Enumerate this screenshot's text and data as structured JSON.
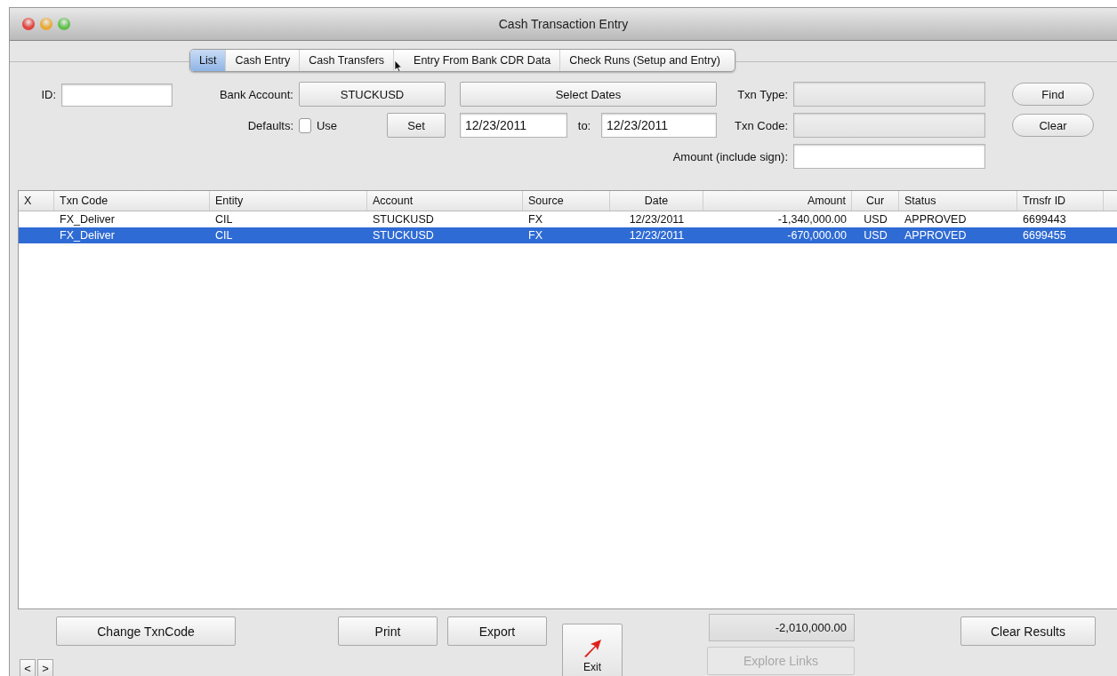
{
  "window": {
    "title": "Cash Transaction Entry"
  },
  "tabs": [
    {
      "label": "List",
      "selected": true
    },
    {
      "label": "Cash Entry",
      "selected": false
    },
    {
      "label": "Cash Transfers",
      "selected": false
    },
    {
      "label": "Entry From Bank CDR Data",
      "selected": false
    },
    {
      "label": "Check Runs (Setup and Entry)",
      "selected": false
    }
  ],
  "filters": {
    "id_label": "ID:",
    "bank_account": {
      "label": "Bank Account:",
      "value": "STUCKUSD"
    },
    "select_dates_button": "Select Dates",
    "defaults": {
      "label": "Defaults:",
      "checkbox_label": "Use",
      "checked": false,
      "set_button": "Set"
    },
    "date_from": "12/23/2011",
    "date_separator": "to:",
    "date_to": "12/23/2011",
    "txn_type_label": "Txn Type:",
    "txn_code_label": "Txn Code:",
    "amount_label": "Amount (include sign):",
    "buttons": [
      "Find",
      "Clear"
    ]
  },
  "table": {
    "columns": [
      "X",
      "Txn Code",
      "Entity",
      "Account",
      "Source",
      "Date",
      "Amount",
      "Cur",
      "Status",
      "Trnsfr ID"
    ],
    "rows": [
      {
        "cells": [
          "",
          "FX_Deliver",
          "CIL",
          "STUCKUSD",
          "FX",
          "12/23/2011",
          "-1,340,000.00",
          "USD",
          "APPROVED",
          "6699443"
        ],
        "selected": false
      },
      {
        "cells": [
          "",
          "FX_Deliver",
          "CIL",
          "STUCKUSD",
          "FX",
          "12/23/2011",
          "-670,000.00",
          "USD",
          "APPROVED",
          "6699455"
        ],
        "selected": true
      }
    ]
  },
  "footer": {
    "change_button": "Change TxnCode",
    "print_button": "Print",
    "export_button": "Export",
    "exit_button": "Exit",
    "total": "-2,010,000.00",
    "explore_links": {
      "label": "Explore Links",
      "disabled": true
    },
    "clear_results_button": "Clear Results",
    "nav_buttons": [
      "<",
      ">"
    ]
  }
}
